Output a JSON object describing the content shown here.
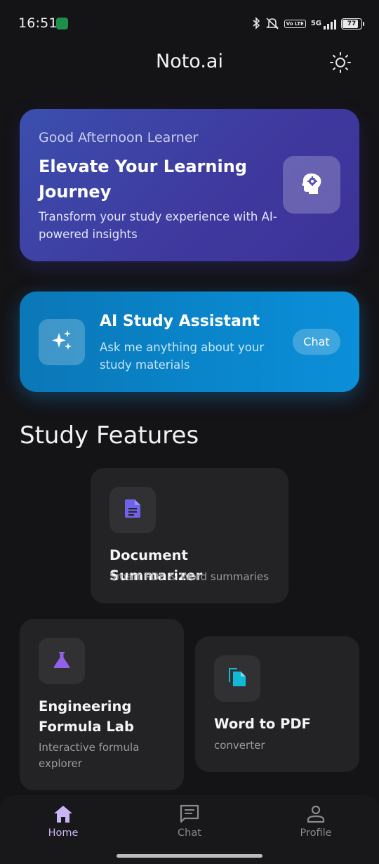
{
  "status_bar": {
    "time": "16:51",
    "battery": "77",
    "network": "5G",
    "volte": "Vo LTE",
    "icons": [
      "bluetooth-icon",
      "mute-icon",
      "volte-icon",
      "signal-icon",
      "battery-icon"
    ]
  },
  "header": {
    "title": "Noto.ai",
    "theme_icon": "sun-icon"
  },
  "hero": {
    "greeting": "Good Afternoon Learner",
    "title": "Elevate Your Learning Journey",
    "subtitle": "Transform your study experience with AI-powered insights",
    "icon": "brain-gear-icon"
  },
  "assistant": {
    "title": "AI Study Assistant",
    "subtitle": "Ask me anything about your study materials",
    "button_label": "Chat",
    "icon": "sparkles-icon"
  },
  "features": {
    "section_title": "Study Features",
    "items": [
      {
        "title": "Document Summarizer",
        "subtitle": "Smart PDF & Word summaries",
        "icon": "document-icon",
        "accent": "#6c5ce7"
      },
      {
        "title": "Engineering Formula Lab",
        "subtitle": "Interactive formula explorer",
        "icon": "flask-icon",
        "accent": "#8e5be8"
      },
      {
        "title": "Word to PDF",
        "subtitle": "converter",
        "icon": "file-copy-icon",
        "accent": "#12b9d6"
      }
    ]
  },
  "bottom_nav": {
    "items": [
      {
        "label": "Home",
        "icon": "home-icon",
        "active": true
      },
      {
        "label": "Chat",
        "icon": "chat-icon",
        "active": false
      },
      {
        "label": "Profile",
        "icon": "profile-icon",
        "active": false
      }
    ]
  },
  "colors": {
    "background": "#141316",
    "card": "#232325",
    "active_nav": "#c9b5f5",
    "inactive_nav": "#8a8a8e"
  }
}
